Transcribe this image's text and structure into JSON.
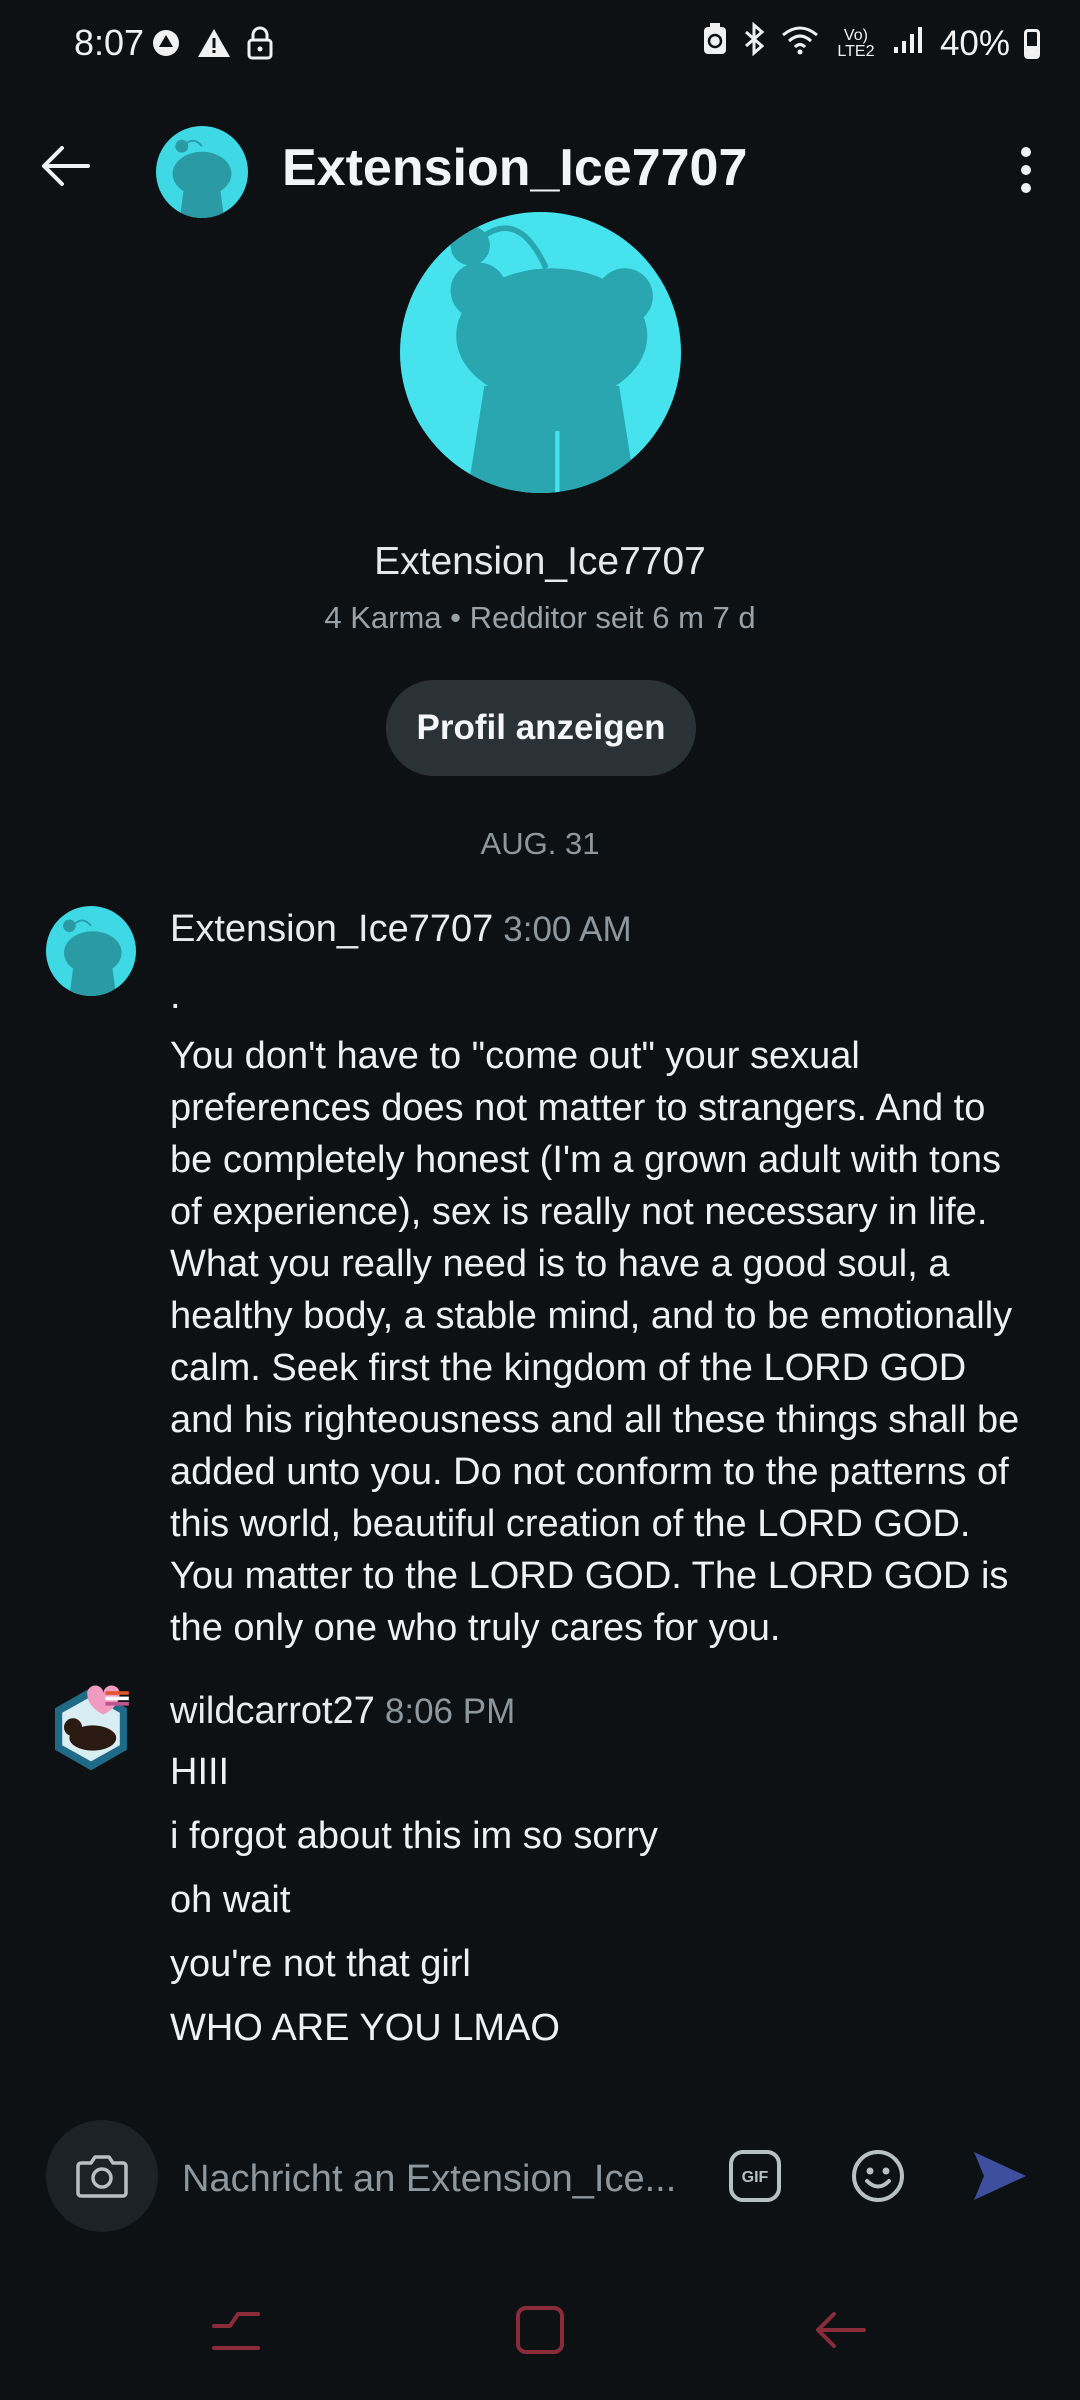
{
  "status_bar": {
    "time": "8:07",
    "battery": "40%",
    "network_label": "Vo) LTE2",
    "left_icons": [
      "vpn-icon",
      "warning-icon",
      "lock-icon"
    ],
    "right_icons": [
      "battery-saver-icon",
      "bluetooth-icon",
      "wifi-icon",
      "signal-icon",
      "battery-icon"
    ]
  },
  "header": {
    "title": "Extension_Ice7707",
    "back_icon": "arrow-left-icon",
    "menu_icon": "more-vertical-icon"
  },
  "profile": {
    "name": "Extension_Ice7707",
    "meta": "4 Karma • Redditor seit 6 m 7 d",
    "view_profile_label": "Profil anzeigen"
  },
  "date_separator": "AUG. 31",
  "messages": [
    {
      "author": "Extension_Ice7707",
      "time": "3:00 AM",
      "lines": [
        ".",
        "You don't have to \"come out\" your sexual preferences does not matter to strangers. And to be completely honest (I'm a grown adult with tons of experience), sex is really not necessary in life. What you really need is to have a good soul, a healthy body, a stable mind, and to be emotionally calm. Seek first the kingdom of the LORD GOD and his righteousness and all these things shall be added unto you. Do not conform to the patterns of this world, beautiful creation of the LORD GOD. You matter to the LORD GOD. The LORD GOD is the only one who truly cares for you."
      ]
    },
    {
      "author": "wildcarrot27",
      "time": "8:06 PM",
      "lines": [
        "HIII",
        "i forgot about this im so sorry",
        "oh wait",
        "you're not that girl",
        "WHO ARE YOU LMAO"
      ]
    }
  ],
  "composer": {
    "placeholder": "Nachricht an Extension_Ice...",
    "gif_label": "GIF"
  },
  "colors": {
    "background": "#0e1113",
    "avatar": "#46e3ee",
    "send": "#3d4f9e",
    "nav": "#8a2b3a"
  }
}
